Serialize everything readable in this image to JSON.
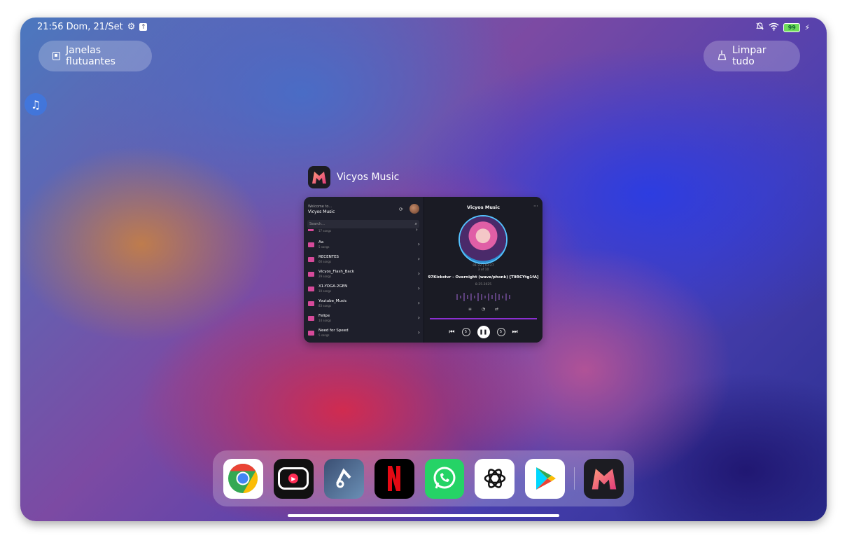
{
  "status_bar": {
    "time_date": "21:56 Dom, 21/Set",
    "battery": "99"
  },
  "buttons": {
    "floating_windows": "Janelas flutuantes",
    "clear_all": "Limpar tudo"
  },
  "recent_app": {
    "name": "Vicyos Music",
    "library": {
      "welcome": "Welcome to...",
      "title": "Vicyos Music",
      "search_placeholder": "Search...",
      "partial_count": "17 songs",
      "folders": [
        {
          "name": "Aa",
          "count": "5 songs"
        },
        {
          "name": "RECENTES",
          "count": "60 songs"
        },
        {
          "name": "Vicyos_Flash_Back",
          "count": "29 songs"
        },
        {
          "name": "X1-YOGA-2GEN",
          "count": "10 songs"
        },
        {
          "name": "Youtube_Music",
          "count": "83 songs"
        },
        {
          "name": "Felipe",
          "count": "14 songs"
        },
        {
          "name": "Need for Speed",
          "count": "5 songs"
        }
      ]
    },
    "player": {
      "title": "Vicyos Music",
      "time": "01:22 | 03:27",
      "index": "3 of 10",
      "track": "97Kickstvr - Overnight (wave/phonk) [T9RCYtg1fA]",
      "date": "8-25-2025",
      "skip_seconds": "5"
    }
  },
  "dock_apps": [
    "Chrome",
    "YouTube Music",
    "TikTok Music",
    "Netflix",
    "WhatsApp",
    "ChatGPT",
    "Google Play Store",
    "Vicyos Music"
  ],
  "colors": {
    "accent_purple": "#8a2fd0",
    "folder_pink": "#d64a9a",
    "battery_green": "#6fdc5b"
  }
}
